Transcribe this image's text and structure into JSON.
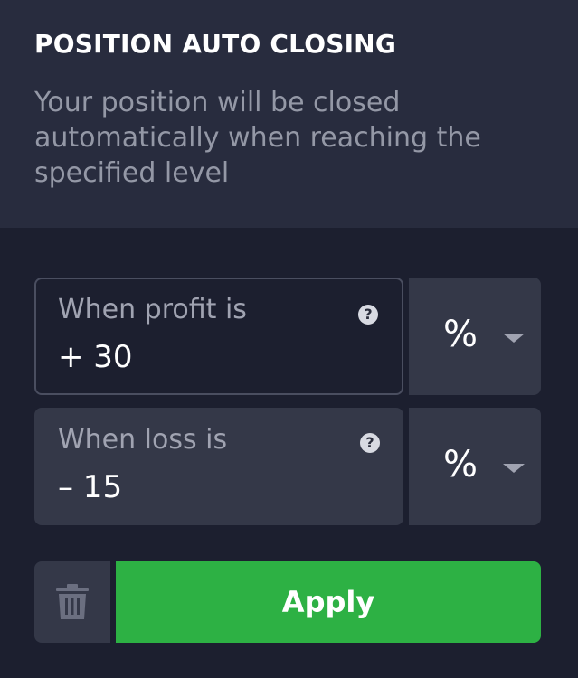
{
  "header": {
    "title": "POSITION AUTO CLOSING",
    "description": "Your position will be closed automatically when reaching the specified level"
  },
  "profit": {
    "label": "When profit is",
    "value": "+ 30",
    "unit": "%",
    "help_icon": "question-circle-icon",
    "unit_icon": "caret-down-icon"
  },
  "loss": {
    "label": "When loss is",
    "value": "– 15",
    "unit": "%",
    "help_icon": "question-circle-icon",
    "unit_icon": "caret-down-icon"
  },
  "actions": {
    "delete_icon": "trash-icon",
    "apply_label": "Apply"
  },
  "colors": {
    "background": "#1c1f2f",
    "header_background": "#282c3e",
    "field_background": "#343848",
    "accent_green": "#2db144",
    "muted_text": "#9498a6"
  }
}
